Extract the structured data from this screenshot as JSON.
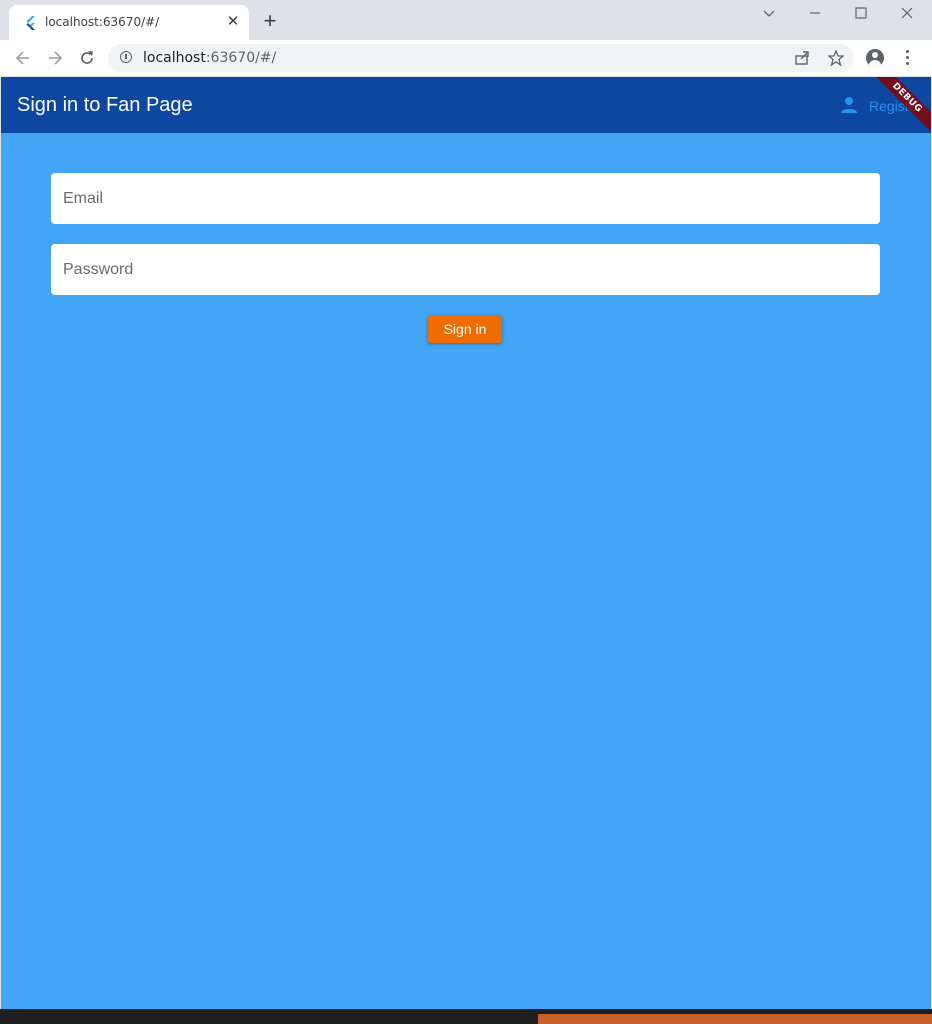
{
  "browser": {
    "tab_title": "localhost:63670/#/",
    "url_host": "localhost",
    "url_rest": ":63670/#/",
    "close_glyph": "✕",
    "new_tab_glyph": "+",
    "icons": [
      "flutter-favicon",
      "close-icon",
      "plus-icon",
      "chevron-down-icon",
      "minimize-icon",
      "maximize-icon",
      "window-close-icon",
      "back-arrow-icon",
      "forward-arrow-icon",
      "reload-icon",
      "info-icon",
      "share-icon",
      "star-icon",
      "profile-icon",
      "kebab-menu-icon"
    ]
  },
  "app": {
    "title": "Sign in to Fan Page",
    "register_label": "Register",
    "debug_label": "DEBUG",
    "email_placeholder": "Email",
    "password_placeholder": "Password",
    "signin_label": "Sign in",
    "colors": {
      "appbar": "#0d47a1",
      "background": "#42a5f5",
      "register_text": "#2196f3",
      "signin_button": "#ef6c00"
    }
  }
}
